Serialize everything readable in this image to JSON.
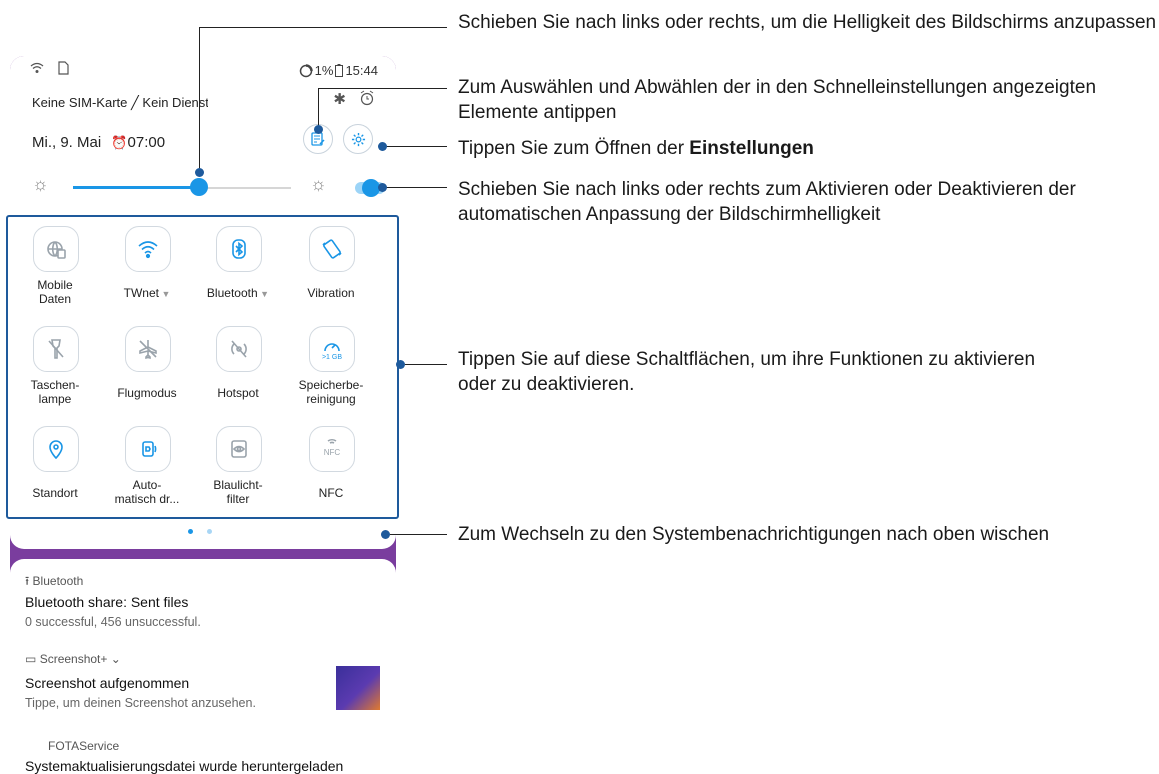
{
  "status_bar": {
    "battery": "1%",
    "time": "15:44"
  },
  "header": {
    "carrier": "Keine SIM-Karte ╱ Kein Dienst",
    "date": "Mi., 9. Mai",
    "alarm": "07:00"
  },
  "brightness": {
    "level": 0.58,
    "auto": true
  },
  "tiles": [
    {
      "label": "Mobile\nDaten",
      "icon": "globe-sim-icon",
      "active": false
    },
    {
      "label": "TWnet",
      "icon": "wifi-icon",
      "active": true,
      "caret": true
    },
    {
      "label": "Bluetooth",
      "icon": "bluetooth-icon",
      "active": true,
      "caret": true
    },
    {
      "label": "Vibration",
      "icon": "vibration-icon",
      "active": true
    },
    {
      "label": "Taschen-\nlampe",
      "icon": "flashlight-off-icon",
      "active": false
    },
    {
      "label": "Flugmodus",
      "icon": "airplane-off-icon",
      "active": false
    },
    {
      "label": "Hotspot",
      "icon": "hotspot-off-icon",
      "active": false
    },
    {
      "label": "Speicherbe-\nreinigung",
      "icon": "memory-clean-icon",
      "active": true,
      "badge": ">1 GB"
    },
    {
      "label": "Standort",
      "icon": "location-icon",
      "active": true
    },
    {
      "label": "Auto-\nmatisch dr...",
      "icon": "auto-rotate-icon",
      "active": true
    },
    {
      "label": "Blaulicht-\nfilter",
      "icon": "eye-filter-icon",
      "active": false
    },
    {
      "label": "NFC",
      "icon": "nfc-icon",
      "active": false
    }
  ],
  "pager": {
    "active_index": 0,
    "count": 2
  },
  "notifications": {
    "n1": {
      "app": "Bluetooth",
      "title": "Bluetooth share: Sent files",
      "text": "0 successful, 456 unsuccessful."
    },
    "n2": {
      "app": "Screenshot+ ⌄",
      "title": "Screenshot aufgenommen",
      "text": "Tippe, um deinen Screenshot anzusehen."
    },
    "n3": {
      "app": "FOTAService",
      "title": "Systemaktualisierungsdatei wurde heruntergeladen"
    }
  },
  "callouts": {
    "brightness": "Schieben Sie nach links oder rechts, um die Helligkeit des Bildschirms anzupassen",
    "edit": "Zum Auswählen und Abwählen der in den Schnelleinstellungen angezeigten Elemente antippen",
    "settings_prefix": "Tippen Sie zum Öffnen der ",
    "settings_bold": "Einstellungen",
    "auto": "Schieben Sie nach links oder rechts zum Aktivieren oder Deaktivieren der automatischen Anpassung der Bildschirmhelligkeit",
    "tiles": "Tippen Sie auf diese Schaltflächen, um ihre Funktionen zu aktivieren oder zu deaktivieren.",
    "swipe": "Zum Wechseln zu den Systembenachrichtigungen nach oben wischen"
  },
  "colors": {
    "accent": "#1a96e6",
    "callout": "#1e5a9c",
    "wallpaper": "#7a3d9e"
  }
}
